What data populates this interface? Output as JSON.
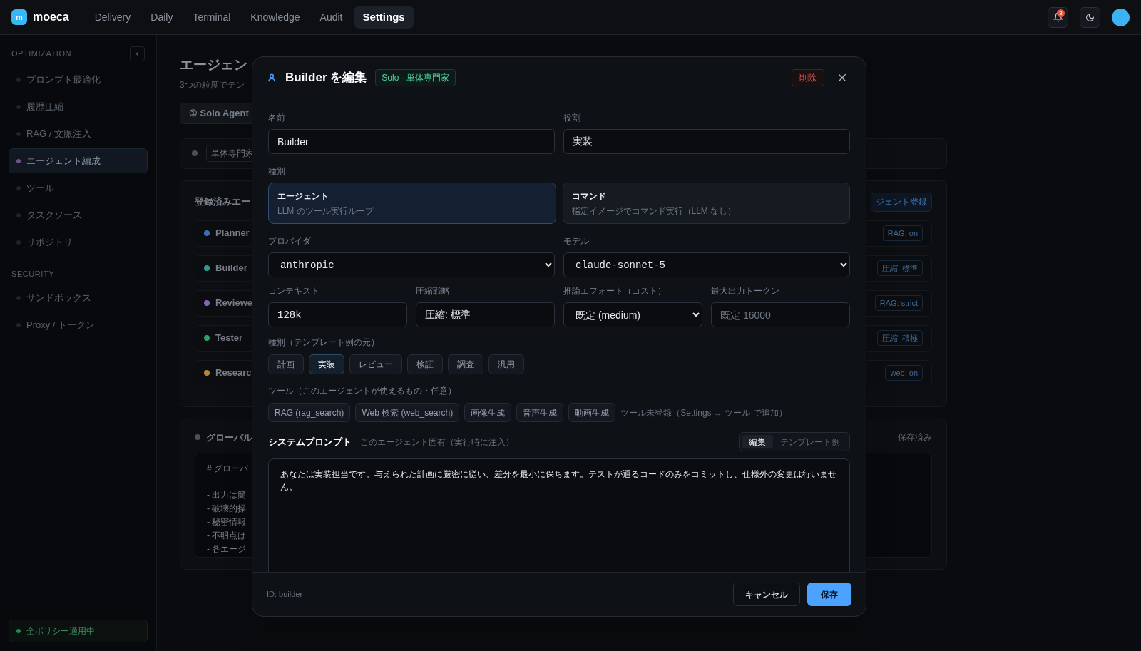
{
  "app": {
    "logo_letter": "m",
    "name": "moeca"
  },
  "nav": [
    {
      "label": "Delivery",
      "selected": false
    },
    {
      "label": "Daily",
      "selected": false
    },
    {
      "label": "Terminal",
      "selected": false
    },
    {
      "label": "Knowledge",
      "selected": false
    },
    {
      "label": "Audit",
      "selected": false
    },
    {
      "label": "Settings",
      "selected": true
    }
  ],
  "header": {
    "notification_count": "3"
  },
  "sidebar": {
    "sections": [
      {
        "title": "OPTIMIZATION",
        "items": [
          {
            "label": "プロンプト最適化",
            "selected": false
          },
          {
            "label": "履歴圧縮",
            "selected": false
          },
          {
            "label": "RAG / 文脈注入",
            "selected": false
          },
          {
            "label": "エージェント編成",
            "selected": true
          },
          {
            "label": "ツール",
            "selected": false
          },
          {
            "label": "タスクソース",
            "selected": false
          },
          {
            "label": "リポジトリ",
            "selected": false
          }
        ]
      },
      {
        "title": "SECURITY",
        "items": [
          {
            "label": "サンドボックス",
            "selected": false
          },
          {
            "label": "Proxy / トークン",
            "selected": false
          }
        ]
      }
    ],
    "status": "全ポリシー適用中"
  },
  "page": {
    "title": "エージェン",
    "subtitle": "3つの粒度でテン",
    "tab": "① Solo Agent",
    "mode_badge": "単体専門家",
    "registered": {
      "title": "登録済みエー",
      "add_button": "ジェント登録",
      "agents": [
        {
          "name": "Planner",
          "color": "#3b6fb8",
          "tag": "RAG: on"
        },
        {
          "name": "Builder",
          "color": "#2a9d8f",
          "tag": "圧縮: 標準"
        },
        {
          "name": "Reviewe",
          "color": "#8a63b8",
          "tag": "RAG: strict"
        },
        {
          "name": "Tester",
          "color": "#2f9e6a",
          "tag": "圧縮: 積極"
        },
        {
          "name": "Researc",
          "color": "#b8862f",
          "tag": "web: on"
        }
      ]
    },
    "global": {
      "title": "グローバル",
      "status": "保存済み",
      "lines": [
        "# グローバ",
        "- 出力は簡",
        "- 破壊的操",
        "- 秘密情報",
        "- 不明点は",
        "- 各エージ"
      ]
    }
  },
  "modal": {
    "title": "Builder を編集",
    "badge": "Solo · 単体専門家",
    "delete": "削除",
    "name": {
      "label": "名前",
      "value": "Builder"
    },
    "role": {
      "label": "役割",
      "value": "実装"
    },
    "kind_label": "種別",
    "kinds": [
      {
        "title": "エージェント",
        "description": "LLM のツール実行ループ",
        "selected": true
      },
      {
        "title": "コマンド",
        "description": "指定イメージでコマンド実行（LLM なし）",
        "selected": false
      }
    ],
    "provider": {
      "label": "プロバイダ",
      "value": "anthropic"
    },
    "model": {
      "label": "モデル",
      "value": "claude-sonnet-5"
    },
    "context": {
      "label": "コンテキスト",
      "value": "128k"
    },
    "compression": {
      "label": "圧縮戦略",
      "value": "圧縮: 標準"
    },
    "effort": {
      "label": "推論エフォート（コスト）",
      "value": "既定 (medium)"
    },
    "max_tokens": {
      "label": "最大出力トークン",
      "placeholder": "既定 16000"
    },
    "category_label": "種別（テンプレート例の元）",
    "categories": [
      {
        "label": "計画",
        "selected": false
      },
      {
        "label": "実装",
        "selected": true
      },
      {
        "label": "レビュー",
        "selected": false
      },
      {
        "label": "検証",
        "selected": false
      },
      {
        "label": "調査",
        "selected": false
      },
      {
        "label": "汎用",
        "selected": false
      }
    ],
    "tools_label": "ツール（このエージェントが使えるもの・任意）",
    "tools": [
      {
        "label": "RAG (rag_search)",
        "selected": false
      },
      {
        "label": "Web 検索 (web_search)",
        "selected": false
      },
      {
        "label": "画像生成",
        "selected": false
      },
      {
        "label": "音声生成",
        "selected": false
      },
      {
        "label": "動画生成",
        "selected": false
      }
    ],
    "tools_hint": "ツール未登録（Settings → ツール で追加）",
    "prompt": {
      "title": "システムプロンプト",
      "hint": "このエージェント固有（実行時に注入）",
      "modes": [
        {
          "label": "編集",
          "selected": true
        },
        {
          "label": "テンプレート例",
          "selected": false
        }
      ],
      "value": "あなたは実装担当です。与えられた計画に厳密に従い、差分を最小に保ちます。テストが通るコードのみをコミットし、仕様外の変更は行いません。"
    },
    "id_text": "ID: builder",
    "cancel": "キャンセル",
    "save": "保存"
  }
}
